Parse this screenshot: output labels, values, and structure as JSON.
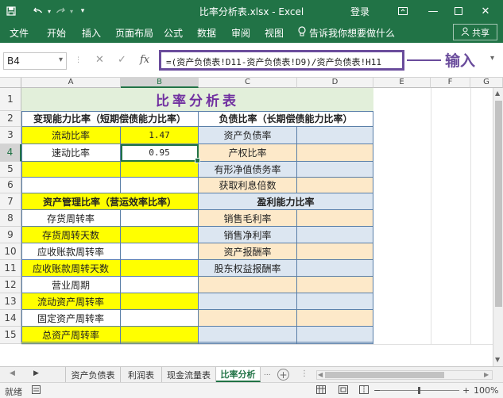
{
  "window": {
    "title": "比率分析表.xlsx - Excel",
    "login": "登录",
    "qat_icons": [
      "save-icon",
      "undo-icon",
      "redo-icon",
      "customize-icon"
    ],
    "win_controls": [
      "ribbon-options-icon",
      "minimize-icon",
      "maximize-icon",
      "close-icon"
    ]
  },
  "ribbon": {
    "tabs": [
      "文件",
      "开始",
      "插入",
      "页面布局",
      "公式",
      "数据",
      "审阅",
      "视图"
    ],
    "tellme": "告诉我你想要做什么",
    "share": "共享"
  },
  "formula_bar": {
    "name_box": "B4",
    "fx": "fx",
    "formula": "=(资产负债表!D11-资产负债表!D9)/资产负债表!H11",
    "callout": "输入"
  },
  "grid": {
    "columns": [
      "A",
      "B",
      "C",
      "D",
      "E",
      "F",
      "G"
    ],
    "selected_column": "B",
    "rows": [
      "1",
      "2",
      "3",
      "4",
      "5",
      "6",
      "7",
      "8",
      "9",
      "10",
      "11",
      "12",
      "13",
      "14",
      "15",
      "16",
      "17"
    ],
    "selected_row": "4"
  },
  "sheet": {
    "title": "比率分析表",
    "left_header_1": "变现能力比率（短期偿债能力比率）",
    "right_header_1": "负债比率（长期偿债能力比率）",
    "left_header_2": "资产管理比率（营运效率比率）",
    "right_header_2": "盈利能力比率",
    "left_items_1": [
      "流动比率",
      "速动比率"
    ],
    "left_values_1": [
      "1.47",
      "0.95"
    ],
    "right_items_1": [
      "资产负债率",
      "产权比率",
      "有形净值债务率",
      "获取利息倍数"
    ],
    "left_items_2": [
      "存货周转率",
      "存货周转天数",
      "应收账款周转率",
      "应收账款周转天数",
      "营业周期",
      "流动资产周转率",
      "固定资产周转率",
      "总资产周转率"
    ],
    "right_items_2": [
      "销售毛利率",
      "销售净利率",
      "资产报酬率",
      "股东权益报酬率"
    ]
  },
  "tabs": {
    "sheets": [
      "资产负债表",
      "利润表",
      "现金流量表",
      "比率分析"
    ],
    "active": "比率分析",
    "more": "..."
  },
  "status": {
    "ready": "就绪",
    "zoom": "100%"
  },
  "colors": {
    "excel_green": "#217346",
    "yellow_fill": "#ffff00",
    "blue_fill": "#dce6f1",
    "peach_fill": "#fde9c9",
    "title_fill": "#e2efda",
    "title_text": "#7030a0",
    "callout": "#6a4c9c"
  }
}
